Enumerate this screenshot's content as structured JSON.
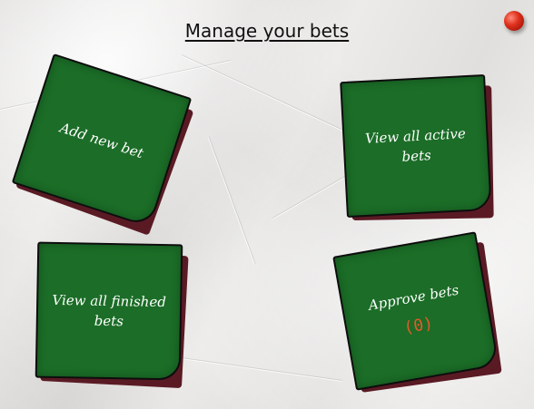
{
  "header": {
    "title": "Manage your bets"
  },
  "notes": {
    "add": {
      "label": "Add new bet"
    },
    "active": {
      "label": "View all active bets"
    },
    "finished": {
      "label": "View all finished bets"
    },
    "approve": {
      "label": "Approve bets",
      "count": "(0)"
    }
  },
  "colors": {
    "note_green": "#1b6d27",
    "note_shadow": "#5a1a24",
    "count_orange": "#e05a2a",
    "pin_red": "#e0321e",
    "paper": "#ecebe9"
  },
  "icons": {
    "pin": "red-push-pin-icon"
  }
}
